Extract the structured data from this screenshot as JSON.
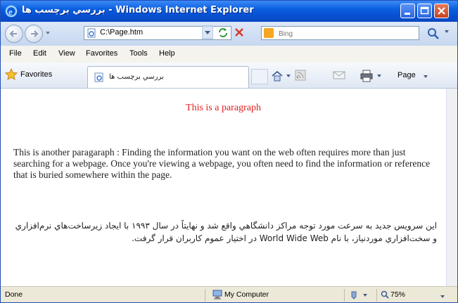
{
  "window": {
    "title_rtl": "بررسي برچسب ها",
    "title_app": " - Windows Internet Explorer"
  },
  "address": {
    "url": "C:\\Page.htm"
  },
  "search": {
    "placeholder": "Bing"
  },
  "menu": {
    "file": "File",
    "edit": "Edit",
    "view": "View",
    "favorites": "Favorites",
    "tools": "Tools",
    "help": "Help"
  },
  "tabs_bar": {
    "favorites_label": "Favorites",
    "tab_label": "بررسي برچسب ها",
    "page_label": "Page"
  },
  "content": {
    "red_paragraph": "This is a paragraph",
    "english_paragraph": "This is another paragaraph : Finding the information you want on the web often requires more than just searching for a webpage. Once you're viewing a webpage, you often need to find the information or reference that is buried somewhere within the page.",
    "persian_paragraph": "اين سرويس جديد به سرعت مورد توجه مراکز دانشگاهي واقع شد و نهايتاً در سال ۱۹۹۳ با ايجاد زيرساخت‌هاي نرم‌افزاري و سخت‌افزاري موردنياز، با نام World Wide Web در اختيار عموم کاربران قرار گرفت."
  },
  "status": {
    "left": "Done",
    "zone": "My Computer",
    "zoom": "75%"
  },
  "colors": {
    "red_text": "#e02020",
    "title_blue": "#0a5fe0"
  }
}
